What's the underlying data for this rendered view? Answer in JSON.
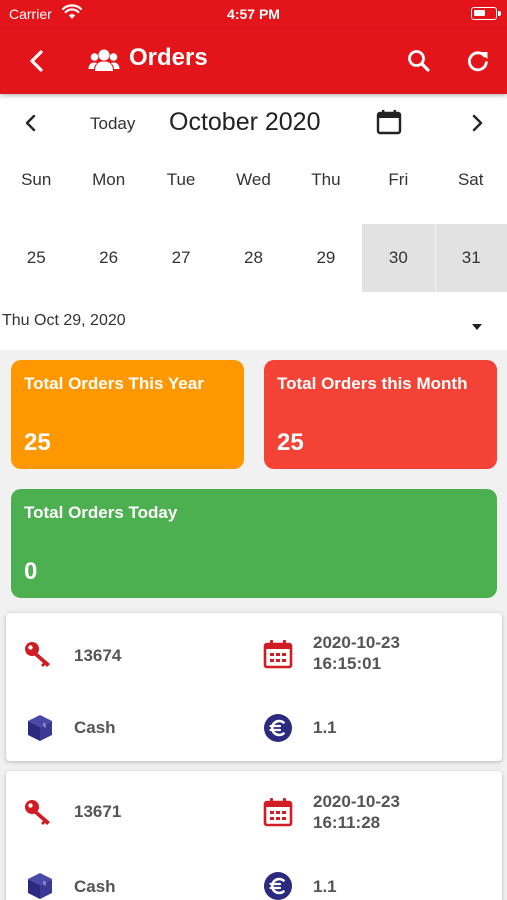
{
  "status_bar": {
    "carrier": "Carrier",
    "time": "4:57 PM"
  },
  "app_bar": {
    "title": "Orders"
  },
  "calendar": {
    "today_label": "Today",
    "month_label": "October 2020",
    "weekdays": [
      "Sun",
      "Mon",
      "Tue",
      "Wed",
      "Thu",
      "Fri",
      "Sat"
    ],
    "days": [
      "25",
      "26",
      "27",
      "28",
      "29",
      "30",
      "31"
    ],
    "shaded_days": [
      "30",
      "31"
    ]
  },
  "date_selector": {
    "label": "Thu Oct 29, 2020"
  },
  "stats": [
    {
      "title": "Total Orders This Year",
      "value": "25",
      "color": "#ff9800"
    },
    {
      "title": "Total Orders this Month",
      "value": "25",
      "color": "#f44336"
    },
    {
      "title": "Total Orders Today",
      "value": "0",
      "color": "#4caf50"
    }
  ],
  "orders": [
    {
      "id": "13674",
      "date": "2020-10-23",
      "time": "16:15:01",
      "payment": "Cash",
      "amount": "1.1"
    },
    {
      "id": "13671",
      "date": "2020-10-23",
      "time": "16:11:28",
      "payment": "Cash",
      "amount": "1.1"
    }
  ],
  "colors": {
    "primary": "#e4141b",
    "icon_red": "#d01c22",
    "icon_navy": "#2b2a7e"
  },
  "icons": [
    "wifi-icon",
    "battery-icon",
    "back-icon",
    "users-icon",
    "search-icon",
    "refresh-icon",
    "chevron-left-icon",
    "calendar-icon",
    "chevron-right-icon",
    "caret-down-icon",
    "key-icon",
    "calendar-grid-icon",
    "box-icon",
    "euro-icon"
  ]
}
